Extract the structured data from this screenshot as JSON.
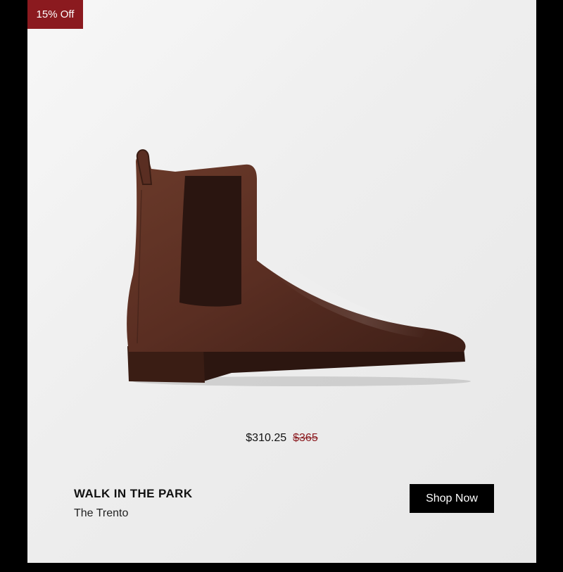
{
  "badge": {
    "label": "15% Off"
  },
  "product": {
    "image_icon": "chelsea-boot-brown",
    "price_current": "$310.25",
    "price_original": "$365",
    "collection": "WALK IN THE PARK",
    "name": "The Trento"
  },
  "cta": {
    "label": "Shop Now"
  },
  "colors": {
    "badge_bg": "#8b1a1f",
    "strike_price": "#8b1a1f",
    "cta_bg": "#000000",
    "page_bg": "#000000",
    "card_bg": "#eeeeee"
  }
}
